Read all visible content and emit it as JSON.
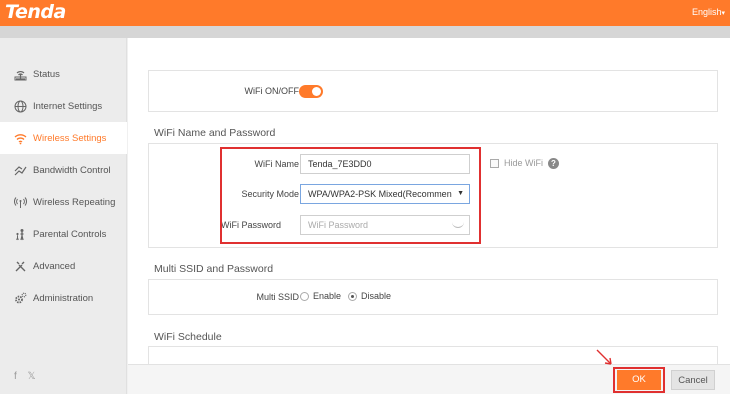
{
  "header": {
    "logo": "Tenda",
    "language": "English"
  },
  "sidebar": {
    "items": [
      {
        "label": "Status",
        "icon": "router-icon"
      },
      {
        "label": "Internet Settings",
        "icon": "globe-icon"
      },
      {
        "label": "Wireless Settings",
        "icon": "wifi-icon",
        "active": true
      },
      {
        "label": "Bandwidth Control",
        "icon": "bandwidth-icon"
      },
      {
        "label": "Wireless Repeating",
        "icon": "repeater-icon"
      },
      {
        "label": "Parental Controls",
        "icon": "parental-icon"
      },
      {
        "label": "Advanced",
        "icon": "tools-icon"
      },
      {
        "label": "Administration",
        "icon": "gears-icon"
      }
    ],
    "social": "f 𝕏"
  },
  "wifi_toggle": {
    "label": "WiFi ON/OFF",
    "state": "on"
  },
  "name_password": {
    "title": "WiFi Name and Password",
    "name_label": "WiFi Name",
    "name_value": "Tenda_7E3DD0",
    "hide_wifi_label": "Hide WiFi",
    "help": "?",
    "security_label": "Security Mode",
    "security_value": "WPA/WPA2-PSK Mixed(Recommen",
    "password_label": "WiFi Password",
    "password_placeholder": "WiFi Password"
  },
  "multi_ssid": {
    "title": "Multi SSID and Password",
    "label": "Multi SSID",
    "enable_label": "Enable",
    "disable_label": "Disable",
    "selected": "Disable"
  },
  "schedule": {
    "title": "WiFi Schedule"
  },
  "footer": {
    "ok_label": "OK",
    "cancel_label": "Cancel"
  },
  "colors": {
    "accent": "#ff7a2a",
    "highlight": "#e03030"
  }
}
